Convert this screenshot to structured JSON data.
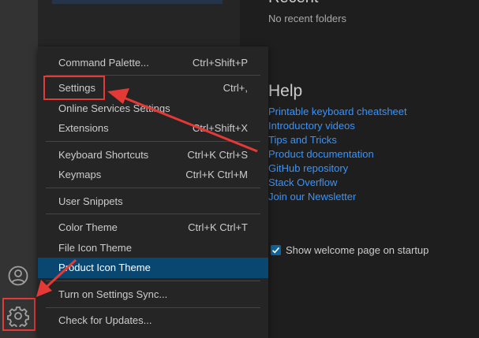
{
  "welcome": {
    "recent_title": "Recent",
    "recent_empty": "No recent folders",
    "help_title": "Help",
    "help_links": [
      "Printable keyboard cheatsheet",
      "Introductory videos",
      "Tips and Tricks",
      "Product documentation",
      "GitHub repository",
      "Stack Overflow",
      "Join our Newsletter"
    ],
    "startup_label": "Show welcome page on startup",
    "startup_checked": true
  },
  "manage_menu": {
    "items": [
      {
        "label": "Command Palette...",
        "shortcut": "Ctrl+Shift+P"
      },
      {
        "label": "Settings",
        "shortcut": "Ctrl+,"
      },
      {
        "label": "Online Services Settings",
        "shortcut": ""
      },
      {
        "label": "Extensions",
        "shortcut": "Ctrl+Shift+X"
      },
      {
        "label": "Keyboard Shortcuts",
        "shortcut": "Ctrl+K Ctrl+S"
      },
      {
        "label": "Keymaps",
        "shortcut": "Ctrl+K Ctrl+M"
      },
      {
        "label": "User Snippets",
        "shortcut": ""
      },
      {
        "label": "Color Theme",
        "shortcut": "Ctrl+K Ctrl+T"
      },
      {
        "label": "File Icon Theme",
        "shortcut": ""
      },
      {
        "label": "Product Icon Theme",
        "shortcut": ""
      },
      {
        "label": "Turn on Settings Sync...",
        "shortcut": ""
      },
      {
        "label": "Check for Updates...",
        "shortcut": ""
      }
    ],
    "selected_item": "Product Icon Theme"
  },
  "activity_bar": {
    "icons": [
      "account-icon",
      "gear-icon"
    ]
  },
  "colors": {
    "accent": "#0e639c",
    "selection": "#094771",
    "link": "#3794ff",
    "annotation": "#e53935"
  }
}
